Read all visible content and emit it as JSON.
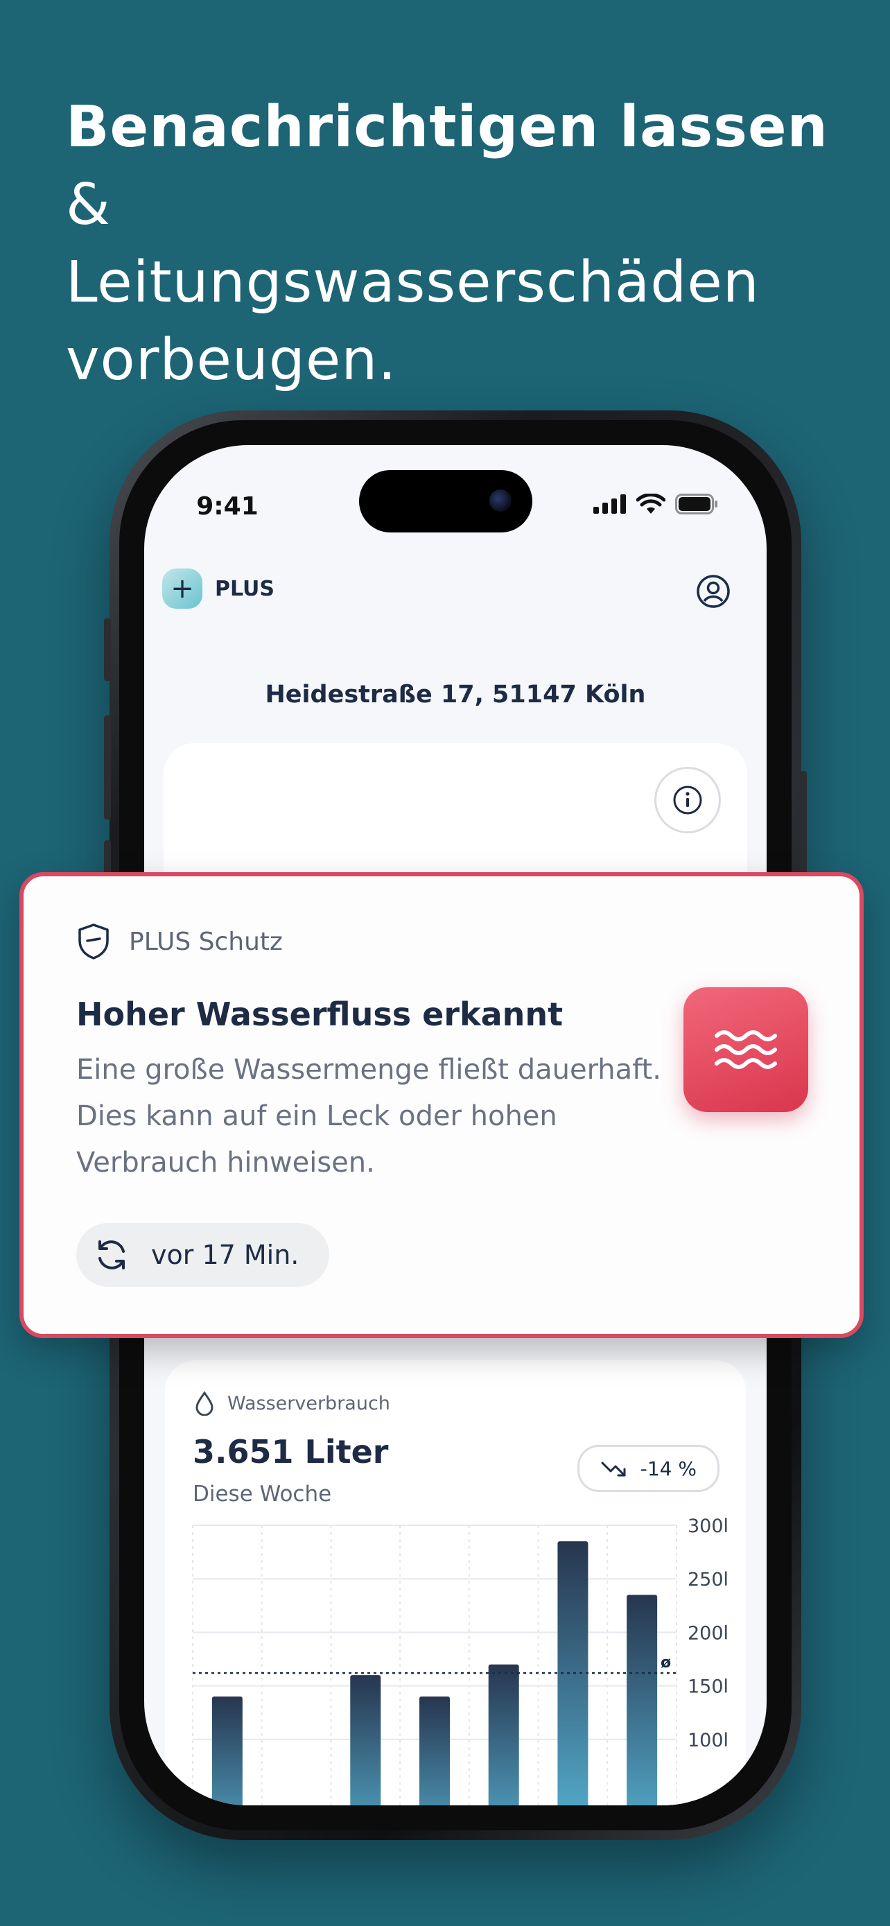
{
  "headline": {
    "bold": "Benachrichtigen lassen",
    "rest_line1": " &",
    "line2": "Leitungswasserschäden",
    "line3": "vorbeugen."
  },
  "status_bar": {
    "time": "9:41"
  },
  "app": {
    "brand": "PLUS",
    "address": "Heidestraße 17, 51147 Köln"
  },
  "notification": {
    "source": "PLUS Schutz",
    "title": "Hoher Wasserfluss erkannt",
    "body": "Eine große Wassermenge fließt dauerhaft. Dies kann auf ein Leck oder hohen Verbrauch hinweisen.",
    "time": "vor 17 Min.",
    "accent_color": "#d9495f"
  },
  "usage": {
    "label": "Wasserverbrauch",
    "value": "3.651 Liter",
    "period": "Diese Woche",
    "trend": "-14 %"
  },
  "chart_data": {
    "type": "bar",
    "values": [
      140,
      27,
      160,
      140,
      170,
      285,
      235
    ],
    "ylim": [
      50,
      300
    ],
    "y_ticks": [
      "300l",
      "250l",
      "200l",
      "150l",
      "100l"
    ],
    "y_tick_values": [
      300,
      250,
      200,
      150,
      100
    ],
    "average": 162,
    "average_label": "ø"
  },
  "colors": {
    "background": "#1d6475",
    "text_dark": "#1d2b45",
    "bar_top": "#27364f",
    "bar_bottom": "#5ec6e8"
  }
}
